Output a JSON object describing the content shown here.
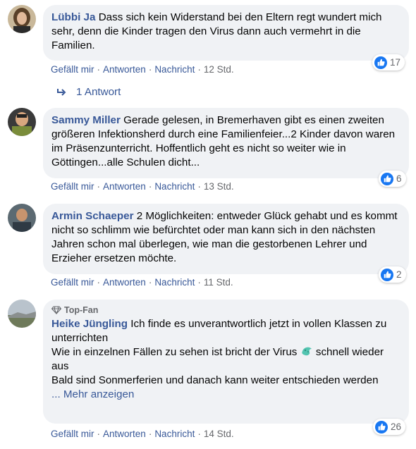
{
  "comments": [
    {
      "author": "Lübbi Ja",
      "text": "Dass sich kein Widerstand bei den Eltern regt wundert mich sehr, denn die Kinder tragen den Virus dann auch vermehrt in die Familien.",
      "like": "Gefällt mir",
      "reply": "Antworten",
      "message": "Nachricht",
      "time": "12 Std.",
      "reactions": "17"
    },
    {
      "author": "Sammy Miller",
      "text": "Gerade gelesen, in Bremerhaven gibt es einen zweiten größeren Infektionsherd durch eine Familienfeier...2 Kinder davon waren im Präsenzunterricht. Hoffentlich geht es nicht so weiter wie in Göttingen...alle Schulen dicht...",
      "like": "Gefällt mir",
      "reply": "Antworten",
      "message": "Nachricht",
      "time": "13 Std.",
      "reactions": "6"
    },
    {
      "author": "Armin Schaeper",
      "text": "2 Möglichkeiten: entweder Glück gehabt und es kommt nicht so schlimm wie befürchtet oder man kann sich in den nächsten Jahren schon mal überlegen, wie man die gestorbenen Lehrer und Erzieher ersetzen möchte.",
      "like": "Gefällt mir",
      "reply": "Antworten",
      "message": "Nachricht",
      "time": "11 Std.",
      "reactions": "2"
    },
    {
      "badge": "Top-Fan",
      "author": "Heike Jüngling",
      "text_line1": "Ich finde es unverantwortlich jetzt in vollen Klassen zu unterrichten",
      "text_line2a": "Wie in einzelnen Fällen zu sehen ist bricht der Virus",
      "text_line2b": "schnell wieder aus",
      "text_line3": "Bald sind Sonmerferien und danach kann weiter entschieden werden",
      "more": "... Mehr anzeigen",
      "like": "Gefällt mir",
      "reply": "Antworten",
      "message": "Nachricht",
      "time": "14 Std.",
      "reactions": "26"
    }
  ],
  "replies_link": "1 Antwort",
  "colors": {
    "link": "#385898",
    "bubble": "#f0f2f5",
    "like_blue": "#1877f2",
    "meta": "#65676b"
  }
}
